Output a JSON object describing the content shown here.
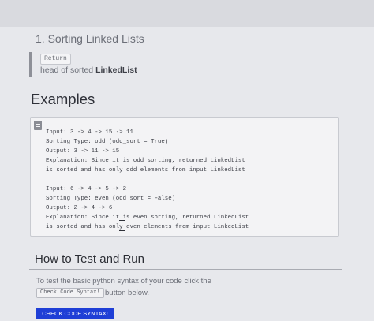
{
  "section": {
    "title": "1. Sorting Linked Lists"
  },
  "returns": {
    "badge": "Return",
    "description_prefix": "head of sorted ",
    "description_bold": "LinkedList"
  },
  "examples": {
    "heading": "Examples",
    "lines": [
      "Input: 3 -> 4 -> 15 -> 11",
      "Sorting Type: odd (odd_sort = True)",
      "Output: 3 -> 11 -> 15",
      "Explanation: Since it is odd sorting, returned LinkedList",
      "is sorted and has only odd elements from input LinkedList",
      "Input: 6 -> 4 -> 5 -> 2",
      "Sorting Type: even (odd_sort = False)",
      "Output: 2 -> 4 -> 6",
      "Explanation: Since it is even sorting, returned LinkedList",
      "is sorted and has only even elements from input LinkedList"
    ]
  },
  "howto": {
    "heading": "How to Test and Run",
    "description": "To test the basic python syntax of your code click the",
    "inline_button": "Check Code Syntax!",
    "description_suffix": "button below.",
    "button_label": "CHECK CODE SYNTAX!"
  },
  "colors": {
    "accent": "#1f3fd6",
    "page_background": "#e7e8ec",
    "code_background": "#f3f3f5"
  },
  "icons": {
    "example_icon": "document-icon"
  }
}
